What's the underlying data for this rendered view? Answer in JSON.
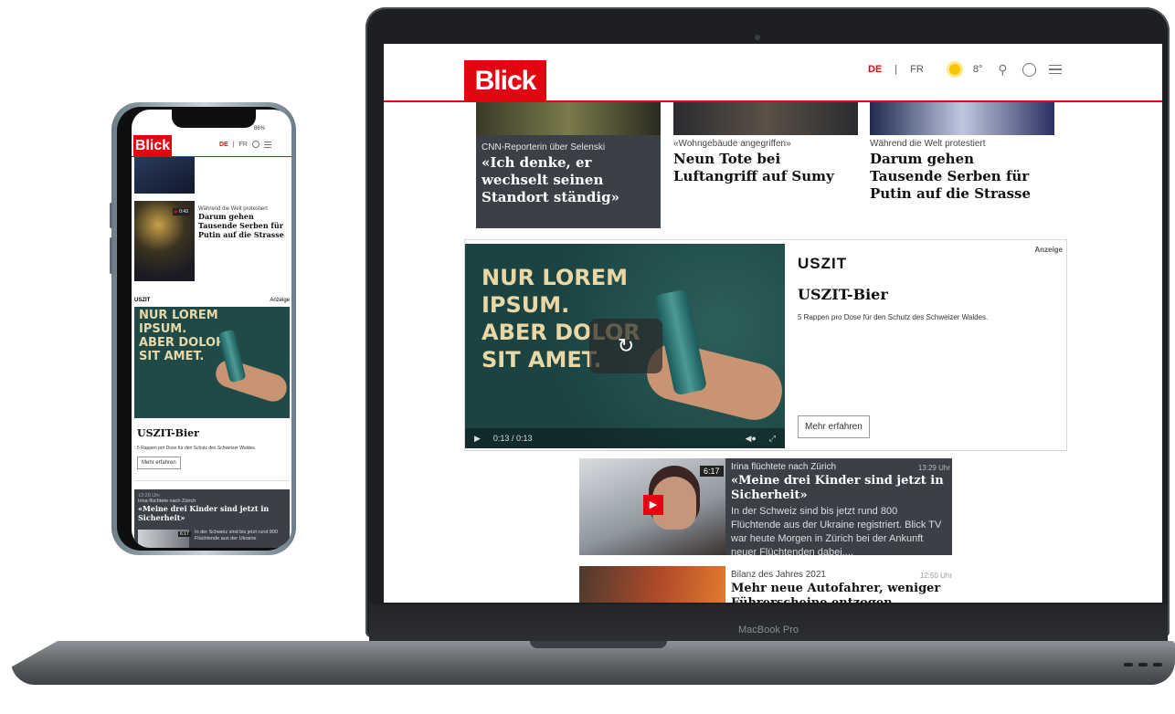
{
  "laptop": {
    "brand": "MacBook Pro",
    "header": {
      "logo": "Blick",
      "lang_de": "DE",
      "separator": "|",
      "lang_fr": "FR",
      "temperature": "8°"
    },
    "cards": [
      {
        "kicker": "CNN-Reporterin über Selenski",
        "title": "«Ich denke, er wechselt seinen Standort ständig»"
      },
      {
        "kicker": "«Wohngebäude angegriffen»",
        "title": "Neun Tote bei Luftangriff auf Sumy"
      },
      {
        "kicker": "Während die Welt protestiert",
        "title": "Darum gehen Tausende Serben für Putin auf die Strasse"
      }
    ],
    "ad": {
      "brand": "USZIT",
      "label": "Anzeige",
      "creative_text": [
        "NUR LOREM",
        "IPSUM.",
        "ABER DOLOR",
        "SIT AMET."
      ],
      "title": "USZIT-Bier",
      "description": "5 Rappen pro Dose für den Schutz des Schweizer Waldes.",
      "button": "Mehr erfahren",
      "time_display": "0:13 / 0:13"
    },
    "video_article": {
      "duration": "6:17",
      "kicker": "Irina flüchtete nach Zürich",
      "time": "13:29 Uhr",
      "title": "«Meine drei Kinder sind jetzt in Sicherheit»",
      "teaser": "In der Schweiz sind bis jetzt rund 800 Flüchtende aus der Ukraine registriert. Blick TV war heute Morgen in Zürich bei der Ankunft neuer Flüchtenden dabei...."
    },
    "article2": {
      "kicker": "Bilanz des Jahres 2021",
      "time": "12:50 Uhr",
      "title": "Mehr neue Autofahrer, weniger Führerscheine entzogen"
    }
  },
  "phone": {
    "status": "86%",
    "header": {
      "logo": "Blick",
      "lang_de": "DE",
      "separator": "|",
      "lang_fr": "FR"
    },
    "article": {
      "video_time": "0:43",
      "kicker": "Während die Welt protestiert",
      "title": "Darum gehen Tausende Serben für Putin auf die Strasse"
    },
    "ad": {
      "brand": "USZIT",
      "label": "Anzeige",
      "creative_text": [
        "NUR LOREM",
        "IPSUM.",
        "ABER DOLOR",
        "SIT AMET."
      ],
      "title": "USZIT-Bier",
      "description": "5 Rappen pro Dose für den Schutz des Schweizer Waldes.",
      "button": "Mehr erfahren"
    },
    "video_article": {
      "time": "13:29 Uhr",
      "kicker": "Irina flüchtete nach Zürich",
      "title": "«Meine drei Kinder sind jetzt in Sicherheit»",
      "duration": "6:17",
      "teaser": "In der Schweiz sind bis jetzt rund 800 Flüchtende aus der Ukraine"
    }
  },
  "colors": {
    "brand_red": "#e20613",
    "dark_card": "#3b3f46",
    "ad_green": "#1f4a48",
    "ad_text": "#e9d8a6"
  }
}
